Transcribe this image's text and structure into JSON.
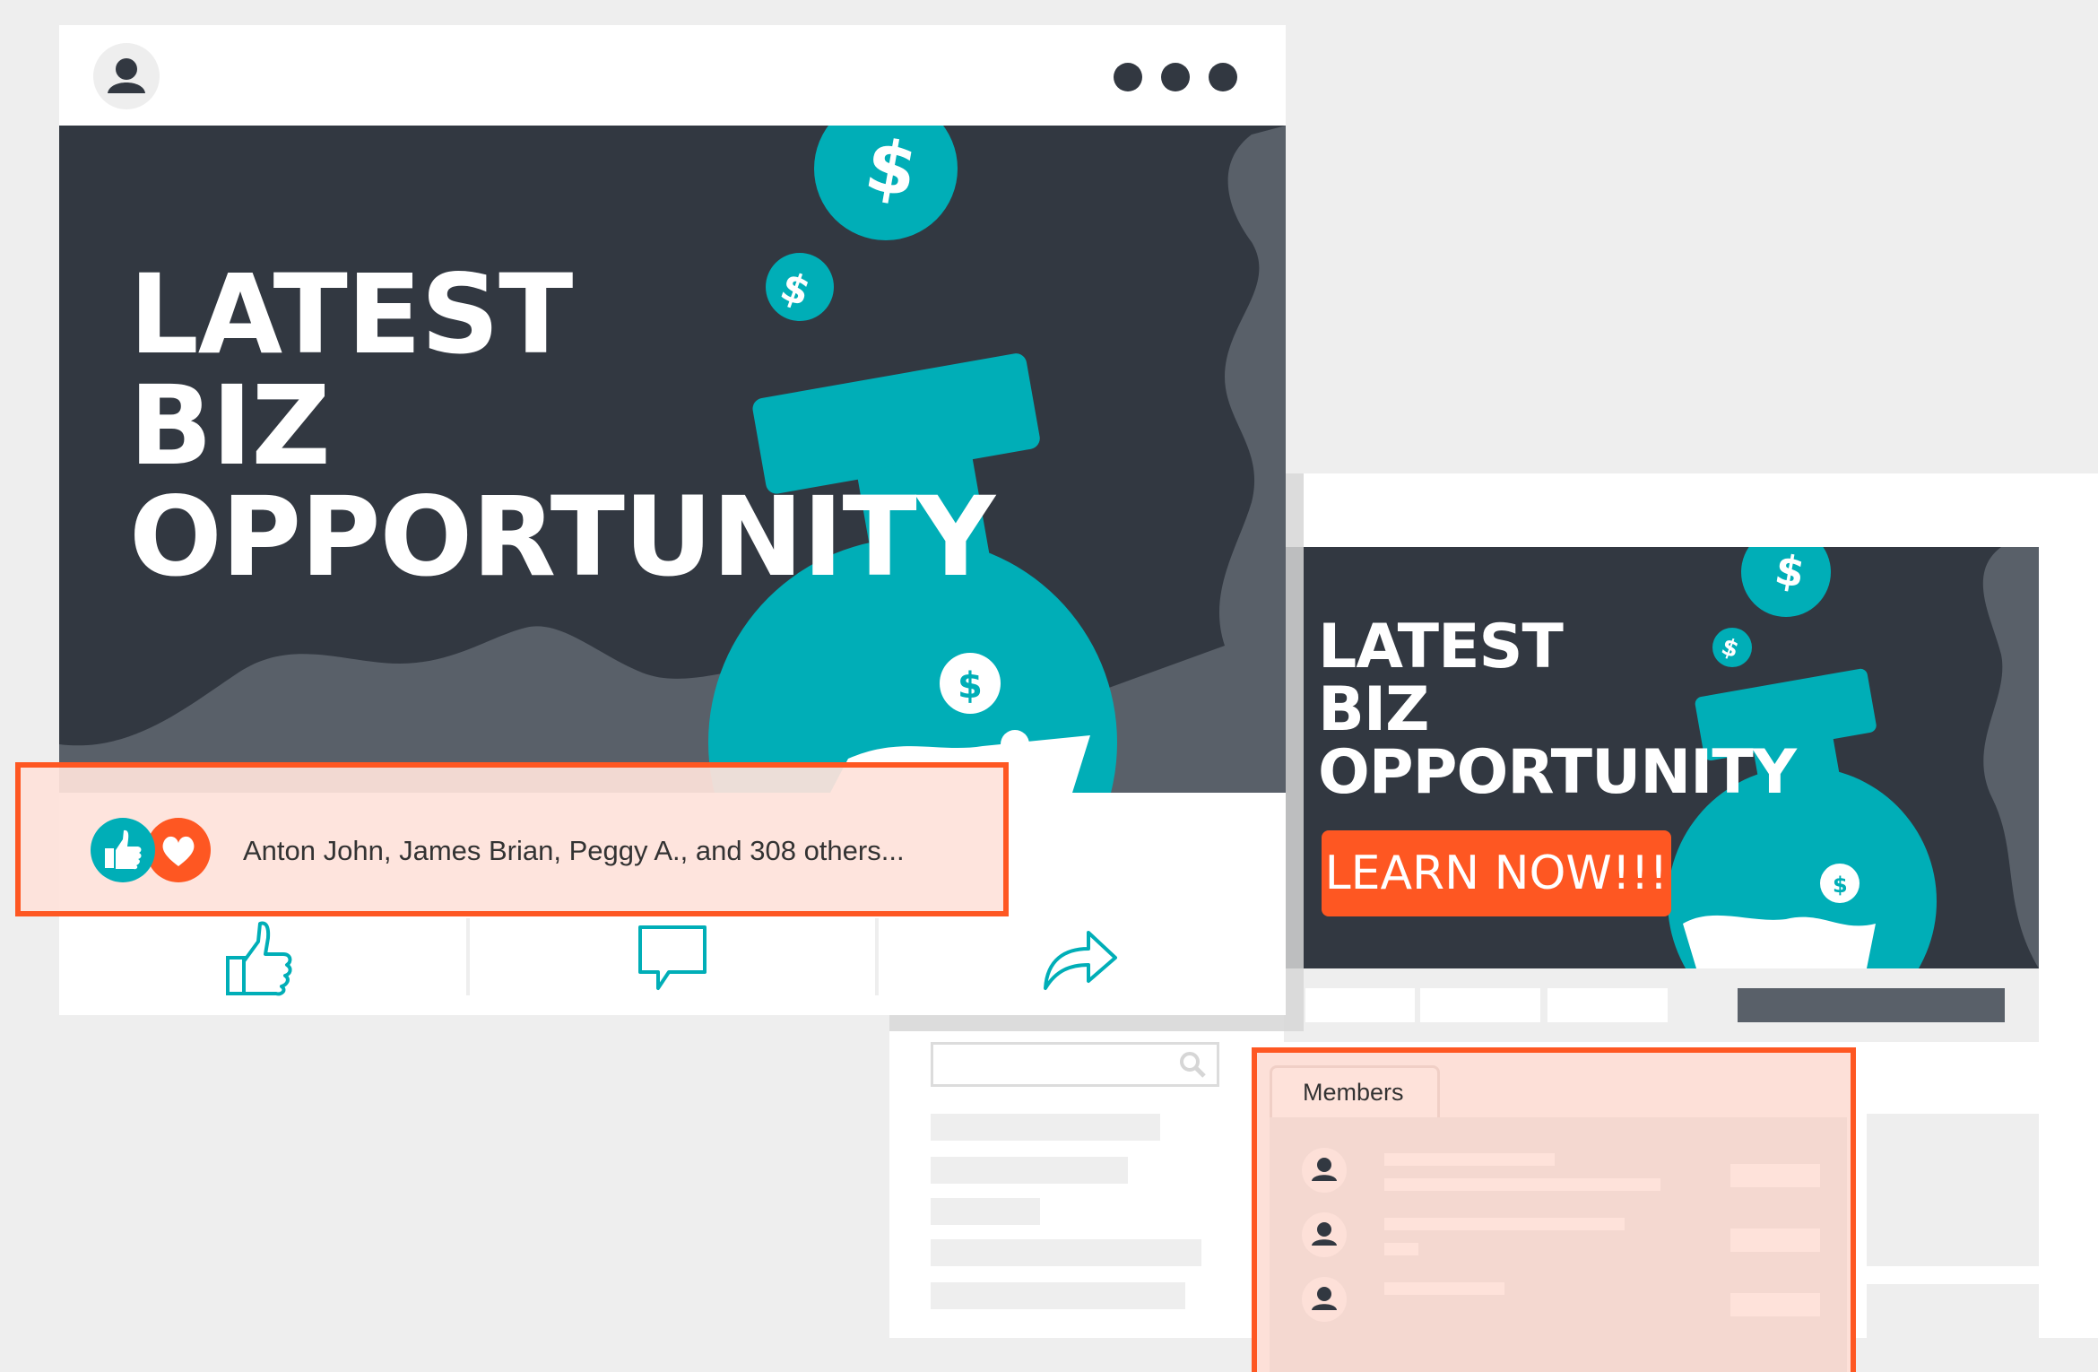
{
  "post": {
    "headline": [
      "LATEST",
      "BIZ",
      "OPPORTUNITY"
    ],
    "reactions_text": "Anton John, James Brian, Peggy A., and 308 others...",
    "actions": [
      "like",
      "comment",
      "share"
    ]
  },
  "page": {
    "headline": [
      "LATEST",
      "BIZ",
      "OPPORTUNITY"
    ],
    "cta_label": "LEARN NOW!!!",
    "members_tab": "Members"
  },
  "icons": {
    "avatar": "user-avatar-icon",
    "more": "more-dots-icon",
    "like_reaction": "thumbs-up-icon",
    "love_reaction": "heart-icon",
    "like_action": "thumbs-up-outline-icon",
    "comment_action": "comment-bubble-icon",
    "share_action": "share-arrow-icon",
    "search": "search-icon"
  },
  "colors": {
    "dark": "#323841",
    "teal": "#00aeb7",
    "accent": "#fe5722",
    "highlight": "#fee2da",
    "gray_shape": "#596069"
  }
}
